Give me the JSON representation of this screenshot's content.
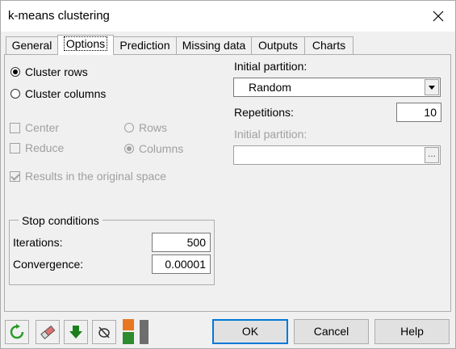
{
  "window": {
    "title": "k-means clustering"
  },
  "tabs": [
    {
      "label": "General"
    },
    {
      "label": "Options"
    },
    {
      "label": "Prediction"
    },
    {
      "label": "Missing data"
    },
    {
      "label": "Outputs"
    },
    {
      "label": "Charts"
    }
  ],
  "active_tab": "Options",
  "left": {
    "cluster_rows_label": "Cluster rows",
    "cluster_columns_label": "Cluster columns",
    "center_label": "Center",
    "reduce_label": "Reduce",
    "rows_label": "Rows",
    "columns_label": "Columns",
    "results_label": "Results in the original space"
  },
  "stop": {
    "title": "Stop conditions",
    "iterations_label": "Iterations:",
    "iterations_value": "500",
    "convergence_label": "Convergence:",
    "convergence_value": "0.00001"
  },
  "right": {
    "initial_partition_label": "Initial partition:",
    "initial_partition_value": "Random",
    "repetitions_label": "Repetitions:",
    "repetitions_value": "10",
    "initial_partition2_label": "Initial partition:",
    "browse_label": "..."
  },
  "buttons": {
    "ok": "OK",
    "cancel": "Cancel",
    "help": "Help"
  },
  "colors": {
    "accent_green": "#2e8b2e",
    "accent_orange": "#e87722",
    "reset_icon": "#2a9a2a"
  }
}
